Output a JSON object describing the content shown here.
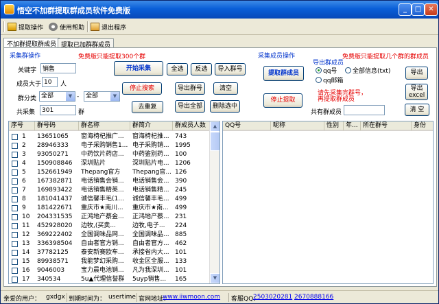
{
  "title": "悟空不加群提取群成员软件免费版",
  "toolbar": {
    "extract": "提取操作",
    "help": "使用帮助",
    "exit": "退出程序"
  },
  "tabs": [
    "不加群提取群成员",
    "提取已加群群成员"
  ],
  "left": {
    "section_label": "采集群操作",
    "warning": "免费版只能提取300个群",
    "keyword_label": "关键字",
    "keyword_value": "销售",
    "members_label": "成员大于",
    "members_value": "10",
    "members_unit": "人",
    "category_label": "群分类",
    "category_value1": "全部",
    "dash": "-",
    "category_value2": "全部",
    "total_label": "共采集",
    "total_value": "301",
    "total_unit": "群",
    "start_btn": "开始采集",
    "stop_btn": "停止搜索",
    "dedup_btn": "去重复",
    "select_all": "全选",
    "invert": "反选",
    "import": "导入群号",
    "export_num": "导出群号",
    "clear": "清空",
    "export_all": "导出全部",
    "delete_sel": "删除选中"
  },
  "right": {
    "section_label": "采集成员操作",
    "warning": "免费版只能提取几个群的群成员",
    "extract_btn": "提取群成员",
    "stop_btn": "停止提取",
    "export_label": "导出群成员",
    "radio_qq": "qq号",
    "radio_all": "全部信息(txt)",
    "radio_mail": "qq邮箱",
    "notice1": "请先采集完群号，",
    "notice2": "再提取群成员",
    "export_btn": "导出",
    "export_excel1": "导出",
    "export_excel2": "excel",
    "total_label": "共有群成员",
    "clear_btn": "清 空"
  },
  "group_table": {
    "headers": [
      "序号",
      "群号码",
      "群名称",
      "群简介",
      "群成员人数"
    ],
    "rows": [
      [
        "1",
        "13651065",
        "窗海椅杞推广...",
        "窗海椅杞推...",
        "743"
      ],
      [
        "2",
        "28946333",
        "电子采购销售1...",
        "电子采购销...",
        "1995"
      ],
      [
        "3",
        "93050271",
        "中药饮片药店...",
        "中药鉴别药...",
        "100"
      ],
      [
        "4",
        "150908846",
        "深圳贴片",
        "深圳贴片电...",
        "1206"
      ],
      [
        "5",
        "152661949",
        "Thepang官方",
        "Thepang官...",
        "126"
      ],
      [
        "6",
        "167382871",
        "电话销售会销...",
        "电话销售会...",
        "390"
      ],
      [
        "7",
        "169893422",
        "电话销售精英...",
        "电话销售精...",
        "245"
      ],
      [
        "8",
        "181041437",
        "诚信馨丰毛(1...",
        "诚信馨丰毛...",
        "499"
      ],
      [
        "9",
        "181422671",
        "重庆市★南川...",
        "重庆市★南...",
        "499"
      ],
      [
        "10",
        "204331535",
        "正鸿地产蔡金...",
        "正鸿地产蔡...",
        "231"
      ],
      [
        "11",
        "452928020",
        "边牧,(买卖...",
        "边牧,电子...",
        "224"
      ],
      [
        "12",
        "369222402",
        "全国调味品网...",
        "全国调味品...",
        "885"
      ],
      [
        "13",
        "336398504",
        "自由者官方销...",
        "自由者官方...",
        "462"
      ],
      [
        "14",
        "37782125",
        "泰安新赛欧车...",
        "承接省内大...",
        "101"
      ],
      [
        "15",
        "89938571",
        "我能梦幻采购...",
        "收金区全服...",
        "133"
      ],
      [
        "16",
        "9046003",
        "宝力晨电池销...",
        "凡为我深圳...",
        "101"
      ],
      [
        "17",
        "340534",
        "5u▲代理信誉群",
        "5uyp销售...",
        "165"
      ]
    ]
  },
  "member_table": {
    "headers": [
      "QQ号",
      "昵称",
      "性别",
      "年...",
      "所在群号",
      "身份"
    ]
  },
  "status": {
    "user_label": "亲爱的用户：",
    "user_value": "gxdgx",
    "expire_label": "到期时间为：",
    "expire_value": "usertime",
    "site_label": "官网地址：",
    "site_value": "www.iiwmoon.com",
    "qq_label": "客服QQ：",
    "qq1": "2503020281",
    "qq2": "2670888166"
  }
}
